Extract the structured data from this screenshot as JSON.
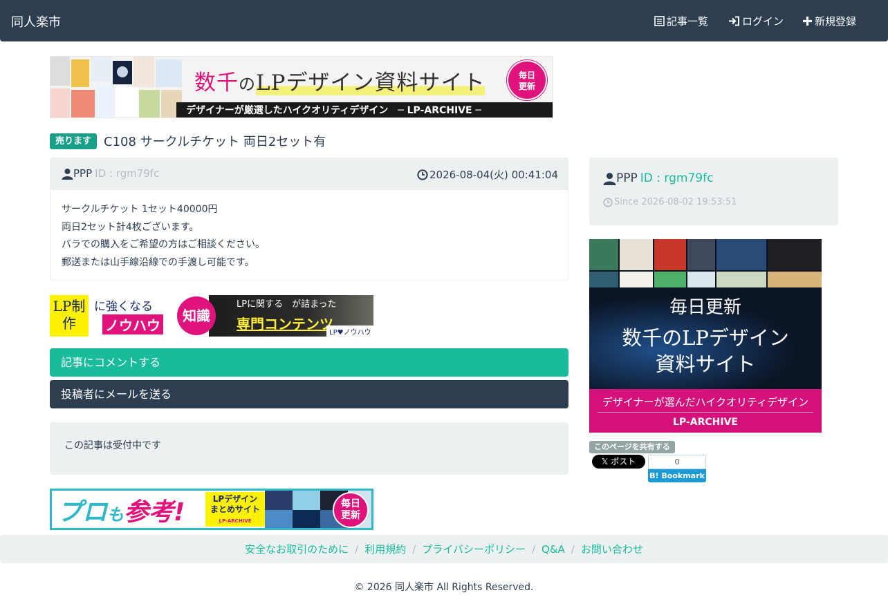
{
  "nav": {
    "brand": "同人楽市",
    "items": [
      {
        "label": "記事一覧",
        "icon": "list-icon"
      },
      {
        "label": "ログイン",
        "icon": "login-icon"
      },
      {
        "label": "新規登録",
        "icon": "plus-icon"
      }
    ]
  },
  "banner_top": {
    "title_pink": "数千",
    "title_no": "の",
    "title_rest": "LPデザイン資料サイト",
    "badge": "毎日更新",
    "strip": "デザイナーが厳選したハイクオリティデザイン　─ LP-ARCHIVE ─"
  },
  "post": {
    "badge": "売ります",
    "title": "C108 サークルチケット 両日2セット有",
    "user": "PPP",
    "user_id": "ID : rgm79fc",
    "date": "2026-08-04(火) 00:41:04",
    "body": [
      "サークルチケット 1セット40000円",
      "両日2セット計4枚ございます。",
      "バラでの購入をご希望の方はご相談ください。",
      "郵送または山手線沿線での手渡し可能です。"
    ]
  },
  "banner_mid": {
    "lp": "LP制作",
    "t1": "に強くなる",
    "t2": "ノウハウ",
    "circle": "知識",
    "t3": "LPに関する　が詰まった",
    "t4": "専門コンテンツ",
    "logo": "LP♥ノウハウ"
  },
  "actions": {
    "comment": "記事にコメントする",
    "mail": "投稿者にメールを送る"
  },
  "status": "この記事は受付中です",
  "banner_bot": {
    "pro": "プロ",
    "mo": "も",
    "ref": "参考!",
    "box1": "LPデザイン",
    "box2": "まとめサイト",
    "box3": "LP-ARCHIVE",
    "badge": "毎日更新"
  },
  "sidebar": {
    "user": "PPP",
    "user_id": "ID : rgm79fc",
    "since": "Since 2026-08-02 19:53:51"
  },
  "banner_side": {
    "t1": "毎日更新",
    "t2a": "数千のLPデザイン",
    "t2b": "資料サイト",
    "f1": "デザイナーが選んだハイクオリティデザイン",
    "f2": "LP-ARCHIVE"
  },
  "share": {
    "label": "このページを共有する",
    "x_post": "𝕏 ポスト",
    "hb_count": "0",
    "hb_label": "B! Bookmark"
  },
  "footer": {
    "links": [
      "安全なお取引のために",
      "利用規約",
      "プライバシーポリシー",
      "Q&A",
      "お問い合わせ"
    ],
    "copyright": "© 2026 同人楽市 All Rights Reserved."
  },
  "colors": {
    "navbar": "#2c3e50",
    "accent": "#18bc9c",
    "badge": "#18a08a",
    "pink": "#e0127c",
    "panel": "#ecf0f1"
  }
}
